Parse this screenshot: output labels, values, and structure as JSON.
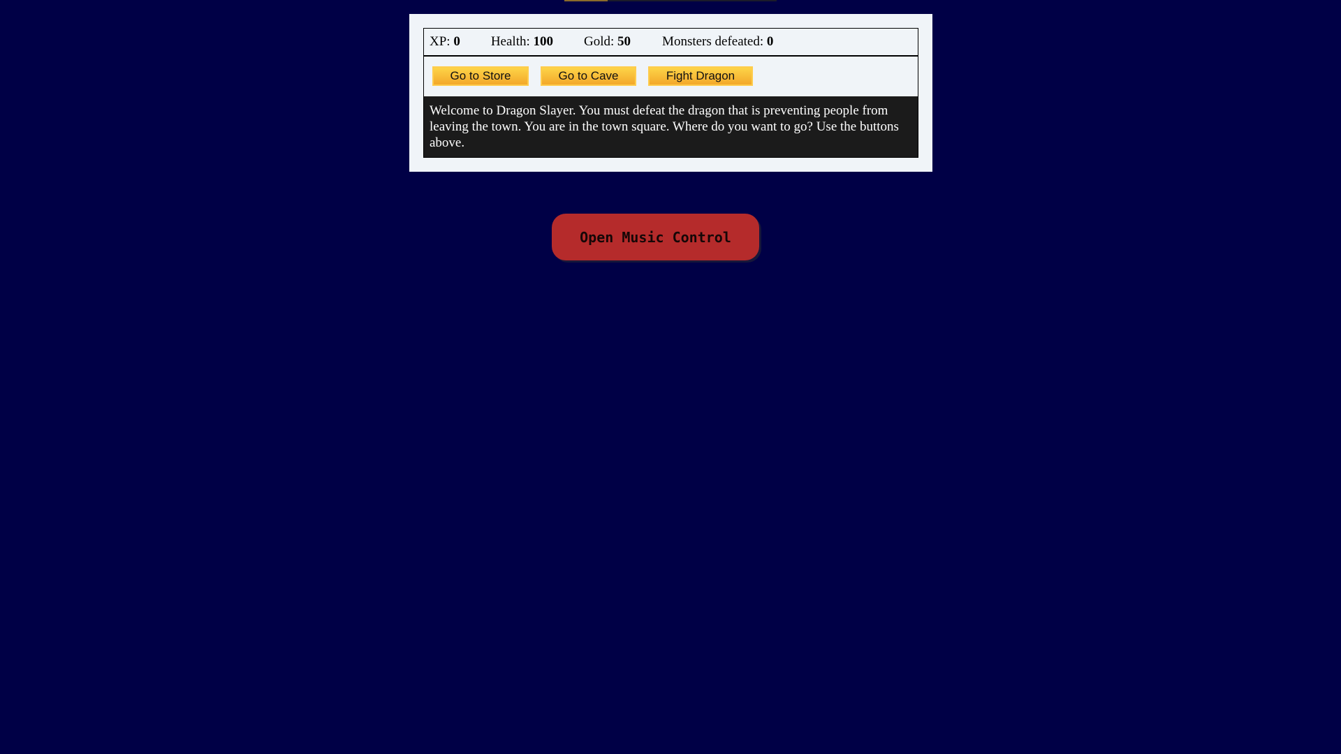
{
  "stats": {
    "xp_label": "XP: ",
    "xp_value": "0",
    "health_label": "Health: ",
    "health_value": "100",
    "gold_label": "Gold: ",
    "gold_value": "50",
    "monsters_label": "Monsters defeated: ",
    "monsters_value": "0"
  },
  "controls": {
    "button1": "Go to Store",
    "button2": "Go to Cave",
    "button3": "Fight Dragon"
  },
  "text": "Welcome to Dragon Slayer. You must defeat the dragon that is preventing people from leaving the town. You are in the town square. Where do you want to go? Use the buttons above.",
  "music": {
    "button_label": "Open Music Control"
  },
  "colors": {
    "background": "#000046",
    "panel": "#f0f4f8",
    "text_box": "#1b1b1b",
    "button_gradient_top": "#fdd448",
    "button_gradient_bottom": "#f3a82a",
    "music_button": "#b52b2b"
  }
}
